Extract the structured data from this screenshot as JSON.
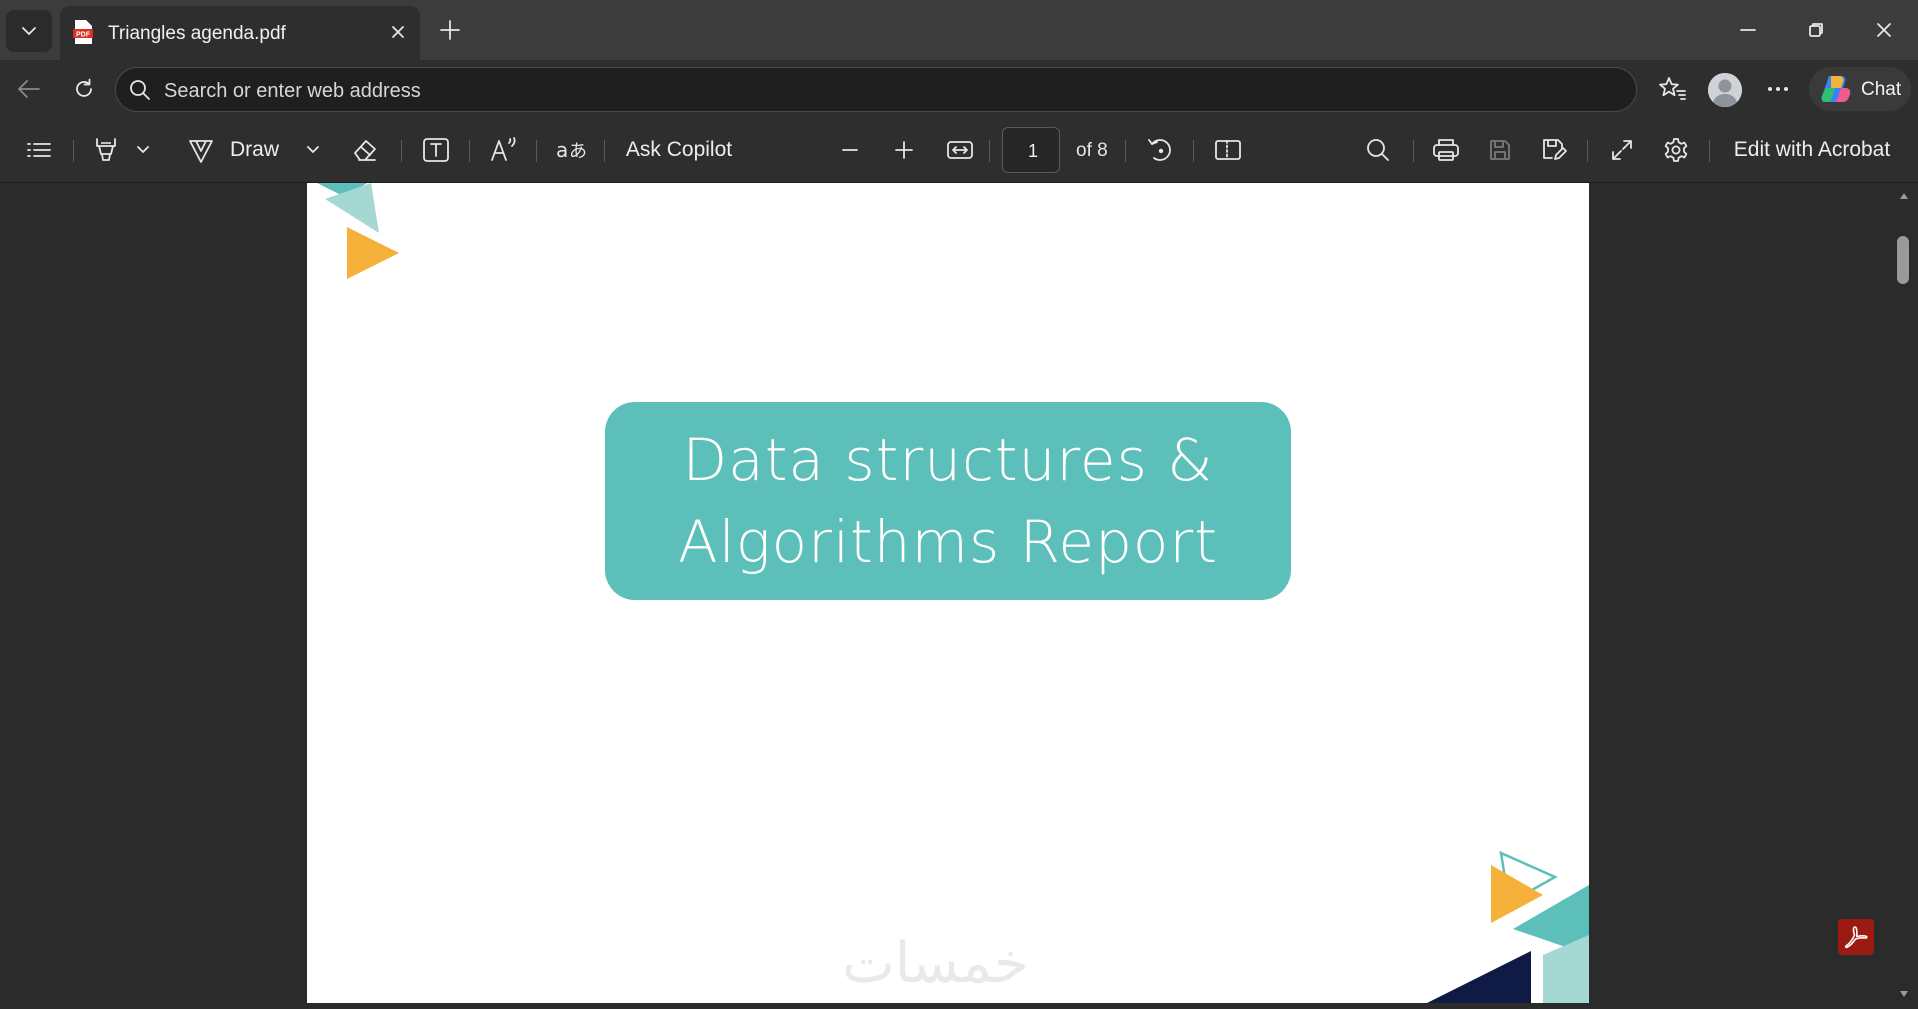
{
  "tab": {
    "title": "Triangles agenda.pdf",
    "icon": "pdf-file-icon"
  },
  "address_bar": {
    "placeholder": "Search or enter web address"
  },
  "browser_actions": {
    "chat_label": "Chat"
  },
  "pdf_toolbar": {
    "draw_label": "Draw",
    "ask_copilot_label": "Ask Copilot",
    "current_page": "1",
    "page_total_text": "of 8",
    "edit_acrobat_label": "Edit with Acrobat"
  },
  "document": {
    "title_line1": "Data structures &",
    "title_line2": "Algorithms Report",
    "watermark": "خمسات",
    "colors": {
      "teal": "#5dbfb9",
      "light_teal": "#a6d8d3",
      "orange": "#f6b13a",
      "navy": "#0f1a45"
    }
  }
}
